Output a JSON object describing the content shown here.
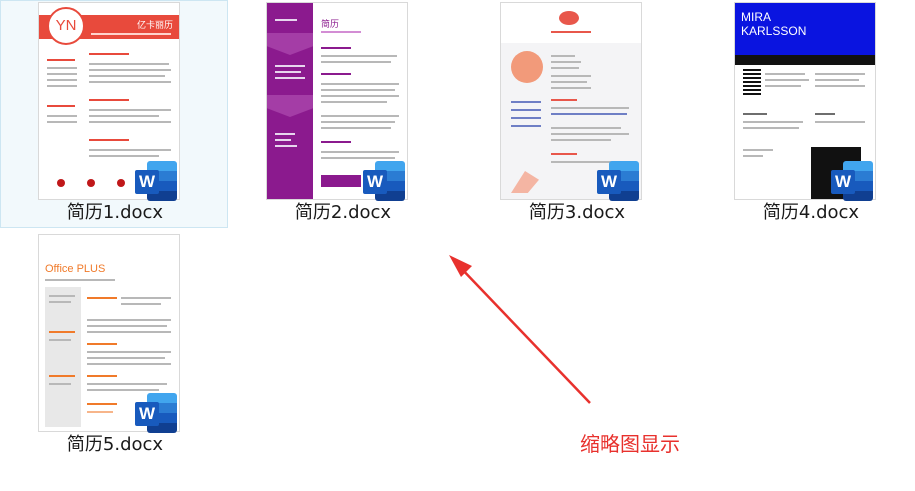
{
  "files": [
    {
      "name": "简历1.docx",
      "selected": true,
      "preview": {
        "monogram": "YN",
        "accent": "#e84a3c",
        "headline": "亿卡丽历"
      }
    },
    {
      "name": "简历2.docx",
      "selected": false,
      "preview": {
        "accent": "#8b1a8e",
        "headline": "简历"
      }
    },
    {
      "name": "简历3.docx",
      "selected": false,
      "preview": {
        "accent": "#e8574b"
      }
    },
    {
      "name": "简历4.docx",
      "selected": false,
      "preview": {
        "first": "MIRA",
        "last": "KARLSSON",
        "accent": "#0a14e0"
      }
    },
    {
      "name": "简历5.docx",
      "selected": false,
      "preview": {
        "brand": "Office PLUS",
        "accent": "#f07a2a"
      }
    }
  ],
  "badge": {
    "letter": "W"
  },
  "annotation": {
    "text": "缩略图显示",
    "color": "#e8312d"
  }
}
